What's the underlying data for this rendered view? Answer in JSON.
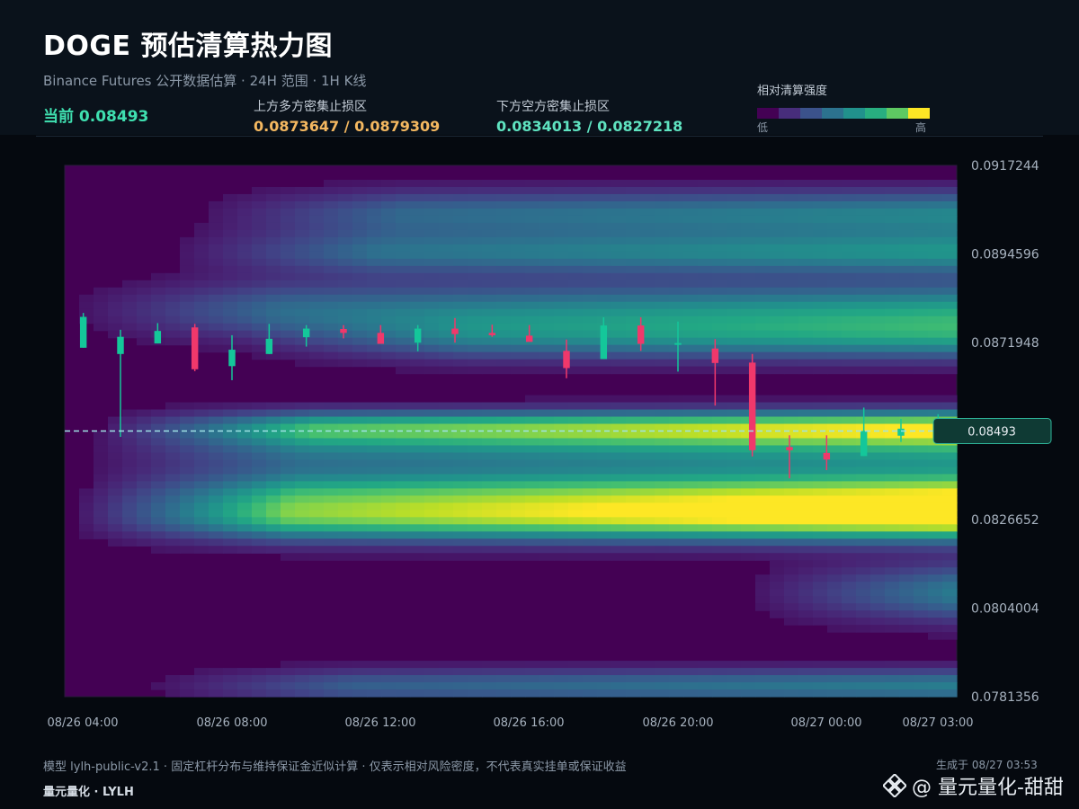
{
  "header": {
    "title": "DOGE 预估清算热力图",
    "subtitle": "Binance Futures 公开数据估算 · 24H 范围 · 1H K线",
    "current_label": "当前 0.08493",
    "upper_label": "上方多方密集止损区",
    "upper_value": "0.0873647 / 0.0879309",
    "lower_label": "下方空方密集止损区",
    "lower_value": "0.0834013 / 0.0827218"
  },
  "legend": {
    "title": "相对清算强度",
    "low": "低",
    "high": "高",
    "colors": [
      "#440154",
      "#472d7b",
      "#3b528b",
      "#2c728e",
      "#21918c",
      "#28ae80",
      "#5ec962",
      "#fde725"
    ]
  },
  "chart_data": {
    "type": "heatmap",
    "y_ticks": [
      "0.0917244",
      "0.0894596",
      "0.0871948",
      "0.0849300",
      "0.0826652",
      "0.0804004",
      "0.0781356"
    ],
    "ylim": [
      0.0781356,
      0.0917244
    ],
    "x_ticks": [
      "08/26 04:00",
      "08/26 08:00",
      "08/26 12:00",
      "08/26 16:00",
      "08/26 20:00",
      "08/27 00:00",
      "08/27 03:00"
    ],
    "current_price": 0.08493,
    "current_price_label": "0.08493",
    "bands": [
      {
        "center": 0.0905,
        "width": 0.0004,
        "intensity": 0.42,
        "start": 0.18
      },
      {
        "center": 0.0895,
        "width": 0.0004,
        "intensity": 0.48,
        "start": 0.15
      },
      {
        "center": 0.088,
        "width": 0.0005,
        "intensity": 0.5,
        "start": 0.04
      },
      {
        "center": 0.0873,
        "width": 0.0004,
        "intensity": 0.4,
        "start": 0.25
      },
      {
        "center": 0.085,
        "width": 0.0003,
        "intensity": 0.88,
        "start": 0.08
      },
      {
        "center": 0.0844,
        "width": 0.0004,
        "intensity": 0.45,
        "start": 0.06
      },
      {
        "center": 0.0834,
        "width": 0.0004,
        "intensity": 0.72,
        "start": 0.06
      },
      {
        "center": 0.0827,
        "width": 0.0004,
        "intensity": 1.0,
        "start": 0.05
      },
      {
        "center": 0.0808,
        "width": 0.0005,
        "intensity": 0.4,
        "start": 0.8
      },
      {
        "center": 0.0784,
        "width": 0.0003,
        "intensity": 0.4,
        "start": 0.12
      }
    ],
    "candles": [
      {
        "t": "08/26 04:00",
        "o": 0.08706,
        "h": 0.08795,
        "l": 0.08706,
        "c": 0.08785
      },
      {
        "t": "08/26 05:00",
        "o": 0.0869,
        "h": 0.08752,
        "l": 0.08478,
        "c": 0.08734
      },
      {
        "t": "08/26 06:00",
        "o": 0.08717,
        "h": 0.08769,
        "l": 0.08717,
        "c": 0.08749
      },
      {
        "t": "08/26 07:00",
        "o": 0.08758,
        "h": 0.08767,
        "l": 0.08646,
        "c": 0.08651
      },
      {
        "t": "08/26 08:00",
        "o": 0.08659,
        "h": 0.08738,
        "l": 0.08623,
        "c": 0.08701
      },
      {
        "t": "08/26 09:00",
        "o": 0.0869,
        "h": 0.08767,
        "l": 0.0869,
        "c": 0.08729
      },
      {
        "t": "08/26 10:00",
        "o": 0.08733,
        "h": 0.08764,
        "l": 0.08709,
        "c": 0.08755
      },
      {
        "t": "08/26 11:00",
        "o": 0.08754,
        "h": 0.08764,
        "l": 0.0873,
        "c": 0.08744
      },
      {
        "t": "08/26 12:00",
        "o": 0.08744,
        "h": 0.08764,
        "l": 0.08716,
        "c": 0.08716
      },
      {
        "t": "08/26 13:00",
        "o": 0.08719,
        "h": 0.08764,
        "l": 0.08697,
        "c": 0.08755
      },
      {
        "t": "08/26 14:00",
        "o": 0.08755,
        "h": 0.08782,
        "l": 0.08719,
        "c": 0.08741
      },
      {
        "t": "08/26 15:00",
        "o": 0.08744,
        "h": 0.08765,
        "l": 0.08734,
        "c": 0.08738
      },
      {
        "t": "08/26 16:00",
        "o": 0.08737,
        "h": 0.08764,
        "l": 0.08723,
        "c": 0.08721
      },
      {
        "t": "08/26 17:00",
        "o": 0.08698,
        "h": 0.08727,
        "l": 0.08628,
        "c": 0.08654
      },
      {
        "t": "08/26 18:00",
        "o": 0.08677,
        "h": 0.08784,
        "l": 0.08677,
        "c": 0.08763
      },
      {
        "t": "08/26 19:00",
        "o": 0.08763,
        "h": 0.08784,
        "l": 0.08698,
        "c": 0.08716
      },
      {
        "t": "08/26 20:00",
        "o": 0.08716,
        "h": 0.08773,
        "l": 0.08645,
        "c": 0.08718
      },
      {
        "t": "08/26 21:00",
        "o": 0.08704,
        "h": 0.08728,
        "l": 0.08558,
        "c": 0.08667
      },
      {
        "t": "08/26 22:00",
        "o": 0.08668,
        "h": 0.0869,
        "l": 0.08428,
        "c": 0.08444
      },
      {
        "t": "08/26 23:00",
        "o": 0.08452,
        "h": 0.08482,
        "l": 0.08372,
        "c": 0.08444
      },
      {
        "t": "08/27 00:00",
        "o": 0.08437,
        "h": 0.08482,
        "l": 0.08393,
        "c": 0.0842
      },
      {
        "t": "08/27 01:00",
        "o": 0.08429,
        "h": 0.08553,
        "l": 0.08429,
        "c": 0.08493
      },
      {
        "t": "08/27 02:00",
        "o": 0.08481,
        "h": 0.08524,
        "l": 0.08465,
        "c": 0.08499
      },
      {
        "t": "08/27 03:00",
        "o": 0.08493,
        "h": 0.08536,
        "l": 0.08493,
        "c": 0.08493
      }
    ]
  },
  "footer": {
    "note": "模型 lylh-public-v2.1 · 固定杠杆分布与维持保证金近似计算 · 仅表示相对风险密度，不代表真实挂单或保证收益",
    "brand": "量元量化 · LYLH",
    "generated": "生成于 08/27 03:53",
    "watermark": "@ 量元量化-甜甜"
  }
}
